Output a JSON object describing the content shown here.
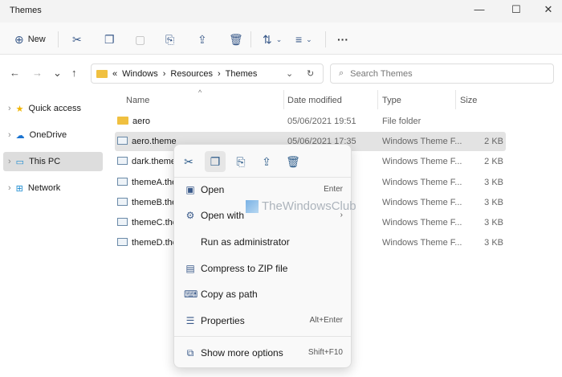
{
  "window": {
    "title": "Themes",
    "minimize": "—",
    "maximize": "☐",
    "close": "✕"
  },
  "toolbar": {
    "new_label": "New",
    "new_icon": "⊕",
    "sort_icon": "⇅",
    "view_icon": "≡",
    "more": "···"
  },
  "address": {
    "overflow": "«",
    "crumbs": [
      "Windows",
      "Resources",
      "Themes"
    ],
    "sep": "›",
    "search_placeholder": "Search Themes"
  },
  "sidebar": {
    "items": [
      {
        "label": "Quick access",
        "icon": "★"
      },
      {
        "label": "OneDrive",
        "icon": "☁"
      },
      {
        "label": "This PC",
        "icon": "▭"
      },
      {
        "label": "Network",
        "icon": "⊞"
      }
    ]
  },
  "columns": {
    "name": "Name",
    "date": "Date modified",
    "type": "Type",
    "size": "Size"
  },
  "files": [
    {
      "name": "aero",
      "date": "05/06/2021 19:51",
      "type": "File folder",
      "size": ""
    },
    {
      "name": "aero.theme",
      "date": "05/06/2021 17:35",
      "type": "Windows Theme F...",
      "size": "2 KB"
    },
    {
      "name": "dark.theme",
      "date": "",
      "type": "Windows Theme F...",
      "size": "2 KB"
    },
    {
      "name": "themeA.ther",
      "date": "",
      "type": "Windows Theme F...",
      "size": "3 KB"
    },
    {
      "name": "themeB.ther",
      "date": "",
      "type": "Windows Theme F...",
      "size": "3 KB"
    },
    {
      "name": "themeC.ther",
      "date": "",
      "type": "Windows Theme F...",
      "size": "3 KB"
    },
    {
      "name": "themeD.ther",
      "date": "",
      "type": "Windows Theme F...",
      "size": "3 KB"
    }
  ],
  "context_menu": {
    "items": [
      {
        "label": "Open",
        "shortcut": "Enter",
        "icon": "▣"
      },
      {
        "label": "Open with",
        "shortcut": "›",
        "icon": "⚙"
      },
      {
        "label": "Run as administrator",
        "shortcut": "",
        "icon": ""
      },
      {
        "label": "Compress to ZIP file",
        "shortcut": "",
        "icon": "▤"
      },
      {
        "label": "Copy as path",
        "shortcut": "",
        "icon": "⌨"
      },
      {
        "label": "Properties",
        "shortcut": "Alt+Enter",
        "icon": "☰"
      },
      {
        "label": "Show more options",
        "shortcut": "Shift+F10",
        "icon": "⧉"
      }
    ]
  },
  "watermark": "TheWindowsClub"
}
